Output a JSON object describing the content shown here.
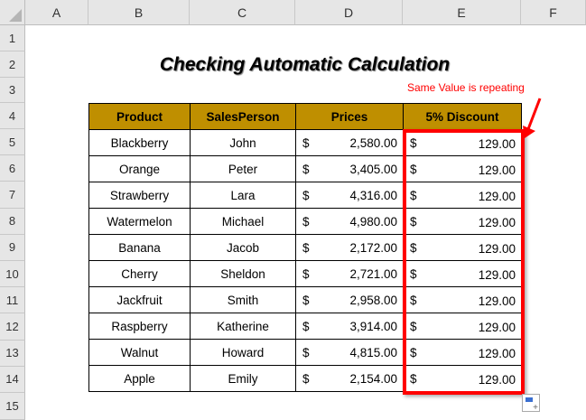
{
  "columns": [
    "A",
    "B",
    "C",
    "D",
    "E",
    "F"
  ],
  "rows": [
    "1",
    "2",
    "3",
    "4",
    "5",
    "6",
    "7",
    "8",
    "9",
    "10",
    "11",
    "12",
    "13",
    "14",
    "15"
  ],
  "title": "Checking Automatic Calculation",
  "annotation": "Same Value is repeating",
  "table": {
    "headers": [
      "Product",
      "SalesPerson",
      "Prices",
      "5% Discount"
    ],
    "currency": "$",
    "rows": [
      [
        "Blackberry",
        "John",
        "2,580.00",
        "129.00"
      ],
      [
        "Orange",
        "Peter",
        "3,405.00",
        "129.00"
      ],
      [
        "Strawberry",
        "Lara",
        "4,316.00",
        "129.00"
      ],
      [
        "Watermelon",
        "Michael",
        "4,980.00",
        "129.00"
      ],
      [
        "Banana",
        "Jacob",
        "2,172.00",
        "129.00"
      ],
      [
        "Cherry",
        "Sheldon",
        "2,721.00",
        "129.00"
      ],
      [
        "Jackfruit",
        "Smith",
        "2,958.00",
        "129.00"
      ],
      [
        "Raspberry",
        "Katherine",
        "3,914.00",
        "129.00"
      ],
      [
        "Walnut",
        "Howard",
        "4,815.00",
        "129.00"
      ],
      [
        "Apple",
        "Emily",
        "2,154.00",
        "129.00"
      ]
    ]
  },
  "colors": {
    "header_fill": "#bf8f00",
    "highlight": "#ff0000"
  }
}
